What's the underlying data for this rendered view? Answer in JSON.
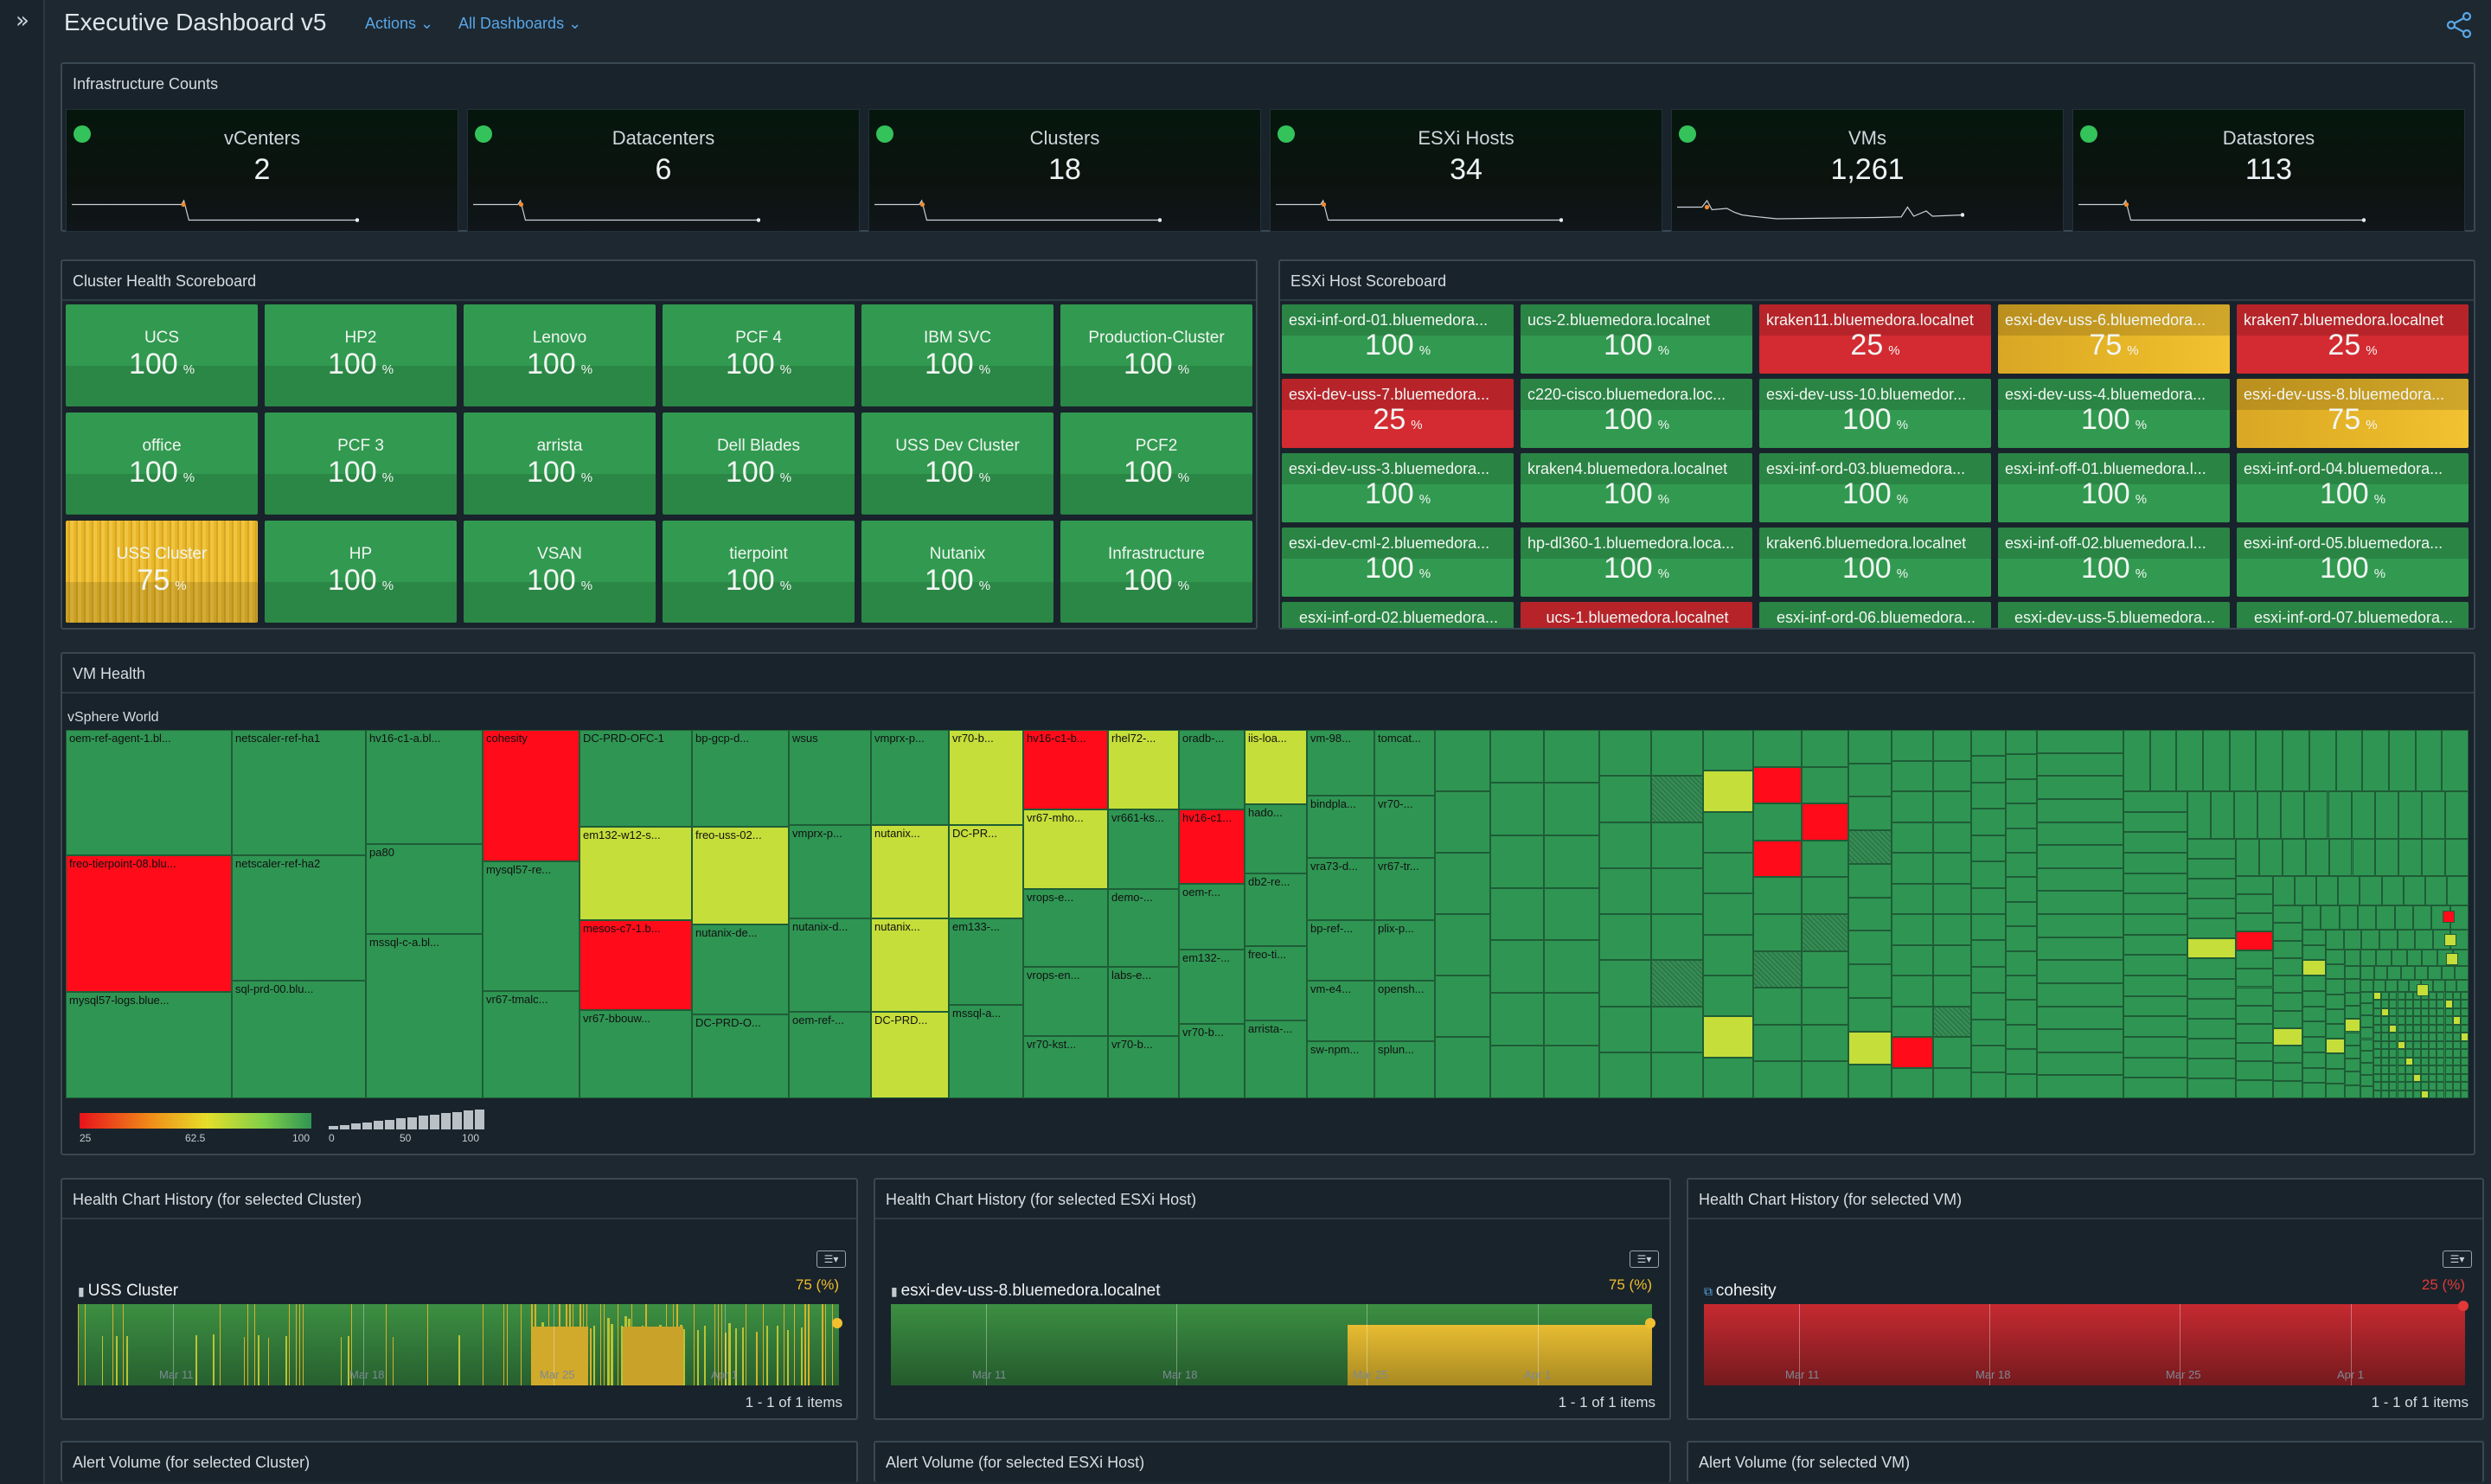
{
  "app": {
    "title": "Executive Dashboard v5",
    "actions_label": "Actions",
    "all_dashboards_label": "All Dashboards",
    "expand_icon": "»"
  },
  "infrastructure": {
    "title": "Infrastructure Counts",
    "counts": [
      {
        "label": "vCenters",
        "value": "2"
      },
      {
        "label": "Datacenters",
        "value": "6"
      },
      {
        "label": "Clusters",
        "value": "18"
      },
      {
        "label": "ESXi Hosts",
        "value": "34"
      },
      {
        "label": "VMs",
        "value": "1,261"
      },
      {
        "label": "Datastores",
        "value": "113"
      }
    ]
  },
  "cluster_scoreboard": {
    "title": "Cluster Health Scoreboard",
    "unit": "%",
    "tiles": [
      {
        "name": "UCS",
        "value": "100",
        "status": "g"
      },
      {
        "name": "HP2",
        "value": "100",
        "status": "g"
      },
      {
        "name": "Lenovo",
        "value": "100",
        "status": "g"
      },
      {
        "name": "PCF 4",
        "value": "100",
        "status": "g"
      },
      {
        "name": "IBM SVC",
        "value": "100",
        "status": "g"
      },
      {
        "name": "Production-Cluster",
        "value": "100",
        "status": "g"
      },
      {
        "name": "office",
        "value": "100",
        "status": "g"
      },
      {
        "name": "PCF 3",
        "value": "100",
        "status": "g"
      },
      {
        "name": "arrista",
        "value": "100",
        "status": "g"
      },
      {
        "name": "Dell Blades",
        "value": "100",
        "status": "g"
      },
      {
        "name": "USS Dev Cluster",
        "value": "100",
        "status": "g"
      },
      {
        "name": "PCF2",
        "value": "100",
        "status": "g"
      },
      {
        "name": "USS Cluster",
        "value": "75",
        "status": "y"
      },
      {
        "name": "HP",
        "value": "100",
        "status": "g"
      },
      {
        "name": "VSAN",
        "value": "100",
        "status": "g"
      },
      {
        "name": "tierpoint",
        "value": "100",
        "status": "g"
      },
      {
        "name": "Nutanix",
        "value": "100",
        "status": "g"
      },
      {
        "name": "Infrastructure",
        "value": "100",
        "status": "g"
      }
    ]
  },
  "esxi_scoreboard": {
    "title": "ESXi Host Scoreboard",
    "unit": "%",
    "tiles": [
      {
        "name": "esxi-inf-ord-01.bluemedora...",
        "value": "100",
        "status": "g"
      },
      {
        "name": "ucs-2.bluemedora.localnet",
        "value": "100",
        "status": "g"
      },
      {
        "name": "kraken11.bluemedora.localnet",
        "value": "25",
        "status": "r"
      },
      {
        "name": "esxi-dev-uss-6.bluemedora...",
        "value": "75",
        "status": "y"
      },
      {
        "name": "kraken7.bluemedora.localnet",
        "value": "25",
        "status": "r"
      },
      {
        "name": "esxi-dev-uss-7.bluemedora...",
        "value": "25",
        "status": "r"
      },
      {
        "name": "c220-cisco.bluemedora.loc...",
        "value": "100",
        "status": "g"
      },
      {
        "name": "esxi-dev-uss-10.bluemedor...",
        "value": "100",
        "status": "g"
      },
      {
        "name": "esxi-dev-uss-4.bluemedora...",
        "value": "100",
        "status": "g"
      },
      {
        "name": "esxi-dev-uss-8.bluemedora...",
        "value": "75",
        "status": "y"
      },
      {
        "name": "esxi-dev-uss-3.bluemedora...",
        "value": "100",
        "status": "g"
      },
      {
        "name": "kraken4.bluemedora.localnet",
        "value": "100",
        "status": "g"
      },
      {
        "name": "esxi-inf-ord-03.bluemedora...",
        "value": "100",
        "status": "g"
      },
      {
        "name": "esxi-inf-off-01.bluemedora.l...",
        "value": "100",
        "status": "g"
      },
      {
        "name": "esxi-inf-ord-04.bluemedora...",
        "value": "100",
        "status": "g"
      },
      {
        "name": "esxi-dev-cml-2.bluemedora...",
        "value": "100",
        "status": "g"
      },
      {
        "name": "hp-dl360-1.bluemedora.loca...",
        "value": "100",
        "status": "g"
      },
      {
        "name": "kraken6.bluemedora.localnet",
        "value": "100",
        "status": "g"
      },
      {
        "name": "esxi-inf-off-02.bluemedora.l...",
        "value": "100",
        "status": "g"
      },
      {
        "name": "esxi-inf-ord-05.bluemedora...",
        "value": "100",
        "status": "g"
      },
      {
        "name": "esxi-inf-ord-02.bluemedora...",
        "value": "",
        "status": "g"
      },
      {
        "name": "ucs-1.bluemedora.localnet",
        "value": "",
        "status": "r"
      },
      {
        "name": "esxi-inf-ord-06.bluemedora...",
        "value": "",
        "status": "g"
      },
      {
        "name": "esxi-dev-uss-5.bluemedora...",
        "value": "",
        "status": "g"
      },
      {
        "name": "esxi-inf-ord-07.bluemedora...",
        "value": "",
        "status": "g"
      }
    ]
  },
  "vm_health": {
    "title": "VM Health",
    "root_label": "vSphere World",
    "labeled_cells": [
      {
        "label": "oem-ref-agent-1.bl...",
        "s": "g"
      },
      {
        "label": "freo-tierpoint-08.blu...",
        "s": "r"
      },
      {
        "label": "mysql57-logs.blue...",
        "s": "g"
      },
      {
        "label": "netscaler-ref-ha1",
        "s": "g"
      },
      {
        "label": "netscaler-ref-ha2",
        "s": "g"
      },
      {
        "label": "sql-prd-00.blu...",
        "s": "g"
      },
      {
        "label": "hv16-c1-a.bl...",
        "s": "g"
      },
      {
        "label": "pa80",
        "s": "g"
      },
      {
        "label": "mssql-c-a.bl...",
        "s": "g"
      },
      {
        "label": "cohesity",
        "s": "r"
      },
      {
        "label": "mysql57-re...",
        "s": "g"
      },
      {
        "label": "vr67-tmalc...",
        "s": "g"
      },
      {
        "label": "DC-PRD-OFC-1",
        "s": "g"
      },
      {
        "label": "em132-w12-s...",
        "s": "y"
      },
      {
        "label": "mesos-c7-1.b...",
        "s": "r"
      },
      {
        "label": "vr67-bbouw...",
        "s": "g"
      },
      {
        "label": "bp-gcp-d...",
        "s": "g"
      },
      {
        "label": "freo-uss-02...",
        "s": "y"
      },
      {
        "label": "nutanix-de...",
        "s": "g"
      },
      {
        "label": "DC-PRD-O...",
        "s": "g"
      },
      {
        "label": "wsus",
        "s": "g"
      },
      {
        "label": "vmprx-p...",
        "s": "g"
      },
      {
        "label": "nutanix-d...",
        "s": "g"
      },
      {
        "label": "oem-ref-...",
        "s": "g"
      },
      {
        "label": "vmprx-p...",
        "s": "g"
      },
      {
        "label": "nutanix...",
        "s": "y"
      },
      {
        "label": "nutanix...",
        "s": "y"
      },
      {
        "label": "DC-PRD...",
        "s": "y"
      },
      {
        "label": "vr70-b...",
        "s": "y"
      },
      {
        "label": "DC-PR...",
        "s": "y"
      },
      {
        "label": "em133-...",
        "s": "g"
      },
      {
        "label": "mssql-a...",
        "s": "g"
      },
      {
        "label": "hv16-c1-b...",
        "s": "r"
      },
      {
        "label": "vr67-mho...",
        "s": "y"
      },
      {
        "label": "vrops-e...",
        "s": "g"
      },
      {
        "label": "vrops-en...",
        "s": "g"
      },
      {
        "label": "vr70-kst...",
        "s": "g"
      },
      {
        "label": "rhel72-...",
        "s": "y"
      },
      {
        "label": "vr661-ks...",
        "s": "g"
      },
      {
        "label": "demo-...",
        "s": "g"
      },
      {
        "label": "labs-e...",
        "s": "g"
      },
      {
        "label": "vr70-b...",
        "s": "g"
      },
      {
        "label": "oradb-...",
        "s": "g"
      },
      {
        "label": "hv16-c1...",
        "s": "r"
      },
      {
        "label": "oem-r...",
        "s": "g"
      },
      {
        "label": "em132-...",
        "s": "g"
      },
      {
        "label": "vr70-b...",
        "s": "g"
      },
      {
        "label": "iis-loa...",
        "s": "y"
      },
      {
        "label": "hado...",
        "s": "g"
      },
      {
        "label": "db2-re...",
        "s": "g"
      },
      {
        "label": "freo-ti...",
        "s": "g"
      },
      {
        "label": "arrista-...",
        "s": "g"
      },
      {
        "label": "vm-98...",
        "s": "g"
      },
      {
        "label": "bindpla...",
        "s": "g"
      },
      {
        "label": "vra73-d...",
        "s": "g"
      },
      {
        "label": "bp-ref-...",
        "s": "g"
      },
      {
        "label": "vm-e4...",
        "s": "g"
      },
      {
        "label": "sw-npm...",
        "s": "g"
      },
      {
        "label": "tomcat...",
        "s": "g"
      },
      {
        "label": "vr70-...",
        "s": "g"
      },
      {
        "label": "vr67-tr...",
        "s": "g"
      },
      {
        "label": "plix-p...",
        "s": "g"
      },
      {
        "label": "opensh...",
        "s": "g"
      },
      {
        "label": "splun...",
        "s": "g"
      }
    ],
    "color_legend": {
      "min": "25",
      "mid": "62.5",
      "max": "100"
    },
    "size_legend": {
      "min": "0",
      "mid": "50",
      "max": "100"
    }
  },
  "health_history": [
    {
      "title": "Health Chart History (for selected Cluster)",
      "object": "USS Cluster",
      "object_icon": "cluster-icon",
      "pct": "75 (%)",
      "dates": [
        "Mar 11",
        "Mar 18",
        "Mar 25",
        "Apr 1"
      ],
      "pager": "1 - 1 of 1 items",
      "pct_color": "#f0bf2a"
    },
    {
      "title": "Health Chart History (for selected ESXi Host)",
      "object": "esxi-dev-uss-8.bluemedora.localnet",
      "object_icon": "host-icon",
      "pct": "75 (%)",
      "dates": [
        "Mar 11",
        "Mar 18",
        "Mar 25",
        "Apr 1"
      ],
      "pager": "1 - 1 of 1 items",
      "pct_color": "#f0bf2a"
    },
    {
      "title": "Health Chart History (for selected VM)",
      "object": "cohesity",
      "object_icon": "vm-icon",
      "pct": "25 (%)",
      "dates": [
        "Mar 11",
        "Mar 18",
        "Mar 25",
        "Apr 1"
      ],
      "pager": "1 - 1 of 1 items",
      "pct_color": "#e23838"
    }
  ],
  "alert_volume": [
    {
      "title": "Alert Volume (for selected Cluster)"
    },
    {
      "title": "Alert Volume (for selected ESXi Host)"
    },
    {
      "title": "Alert Volume (for selected VM)"
    }
  ],
  "colors": {
    "green": "#319a50",
    "red": "#d42a31",
    "yellow": "#e8b729",
    "accent": "#59a6e6"
  }
}
